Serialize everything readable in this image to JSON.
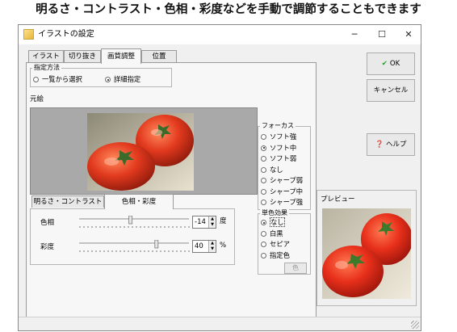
{
  "caption": "明るさ・コントラスト・色相・彩度などを手動で調節することもできます",
  "window": {
    "title": "イラストの設定",
    "minimize": "─",
    "maximize": "☐",
    "close": "✕"
  },
  "tabs": [
    "イラスト",
    "切り抜き",
    "画質調整",
    "位置"
  ],
  "active_tab": 2,
  "designation": {
    "title": "指定方法",
    "options": [
      "一覧から選択",
      "詳細指定"
    ],
    "selected": 1
  },
  "original_label": "元絵",
  "focus": {
    "title": "フォーカス",
    "options": [
      "ソフト強",
      "ソフト中",
      "ソフト弱",
      "なし",
      "シャープ弱",
      "シャープ中",
      "シャープ強"
    ],
    "selected": 1
  },
  "mono": {
    "title": "単色効果",
    "options": [
      "なし",
      "白黒",
      "セピア",
      "指定色"
    ],
    "selected": 0,
    "color_button": "色"
  },
  "subtabs": [
    "明るさ・コントラスト",
    "色相・彩度"
  ],
  "active_subtab": 1,
  "hue": {
    "label": "色相",
    "value": "-14",
    "unit": "度",
    "level": 0.46
  },
  "saturation": {
    "label": "彩度",
    "value": "40",
    "unit": "%",
    "level": 0.7
  },
  "buttons": {
    "ok": "OK",
    "cancel": "キャンセル",
    "help": "ヘルプ"
  },
  "preview_label": "プレビュー",
  "colors": {
    "window_bg": "#f0f0f0",
    "panel_bg": "#f7f7f7",
    "image_area": "#a9a9a9",
    "ok_check": "#1f9e2b",
    "help_icon": "#2461b8"
  }
}
